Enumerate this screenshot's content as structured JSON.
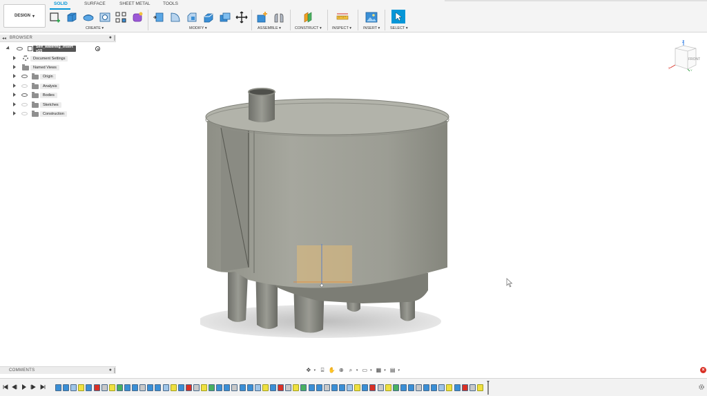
{
  "toolbar": {
    "workspace": "DESIGN",
    "tabs": [
      "SOLID",
      "SURFACE",
      "SHEET METAL",
      "TOOLS"
    ],
    "active_tab": "SOLID",
    "groups": [
      "CREATE",
      "MODIFY",
      "ASSEMBLE",
      "CONSTRUCT",
      "INSPECT",
      "INSERT",
      "SELECT"
    ],
    "accent_color": "#0696d7"
  },
  "browser": {
    "title": "BROWSER",
    "root": "Self_watering_insert v15",
    "items": [
      {
        "label": "Document Settings",
        "icon": "gear-icon"
      },
      {
        "label": "Named Views",
        "icon": "folder-icon"
      },
      {
        "label": "Origin",
        "icon": "folder-icon"
      },
      {
        "label": "Analysis",
        "icon": "folder-icon"
      },
      {
        "label": "Bodies",
        "icon": "folder-icon"
      },
      {
        "label": "Sketches",
        "icon": "folder-icon"
      },
      {
        "label": "Construction",
        "icon": "folder-icon"
      }
    ]
  },
  "viewcube": {
    "face": "FRONT",
    "axis_z": "Z",
    "axis_x": "X",
    "axis_y": "Y"
  },
  "comments": {
    "title": "COMMENTS"
  },
  "model": {
    "body_color": "#a4a59b",
    "highlight_color": "#f0c070"
  }
}
